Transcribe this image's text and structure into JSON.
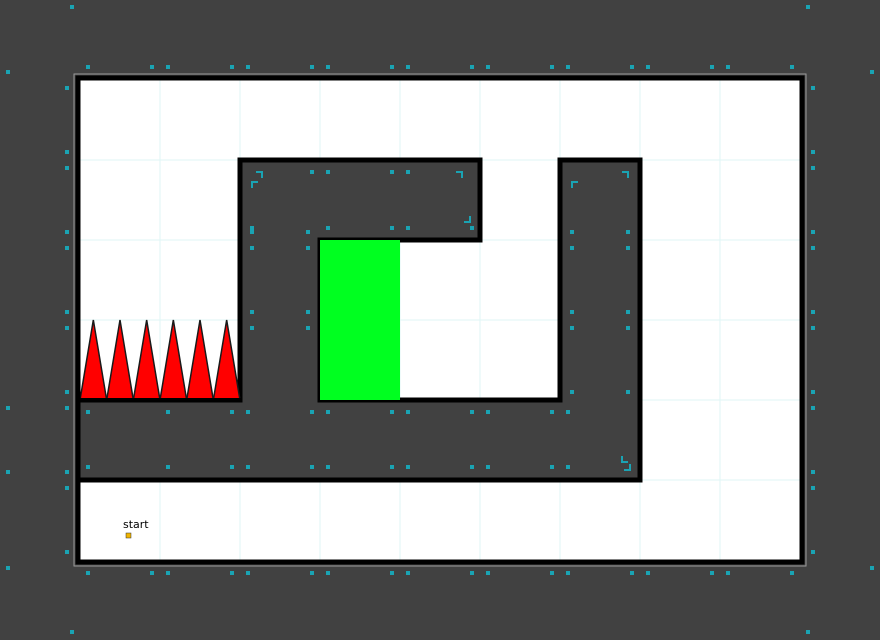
{
  "level": {
    "start_label": "start"
  },
  "colors": {
    "background": "#414141",
    "floor": "#ffffff",
    "wall_edge": "#000000",
    "goal": "#00ff20",
    "spike_fill": "#ff0000",
    "spike_outline": "#1a1a1a",
    "grid_line": "#dff5f5",
    "marker": "#1aa3b3",
    "start_marker": "#f0b400"
  },
  "icons": {
    "goal": "goal-zone",
    "spikes": "spike-hazard-icon",
    "start": "start-marker-icon",
    "corner": "corner-bracket-icon"
  },
  "hazards": {
    "spike_count": 6
  }
}
